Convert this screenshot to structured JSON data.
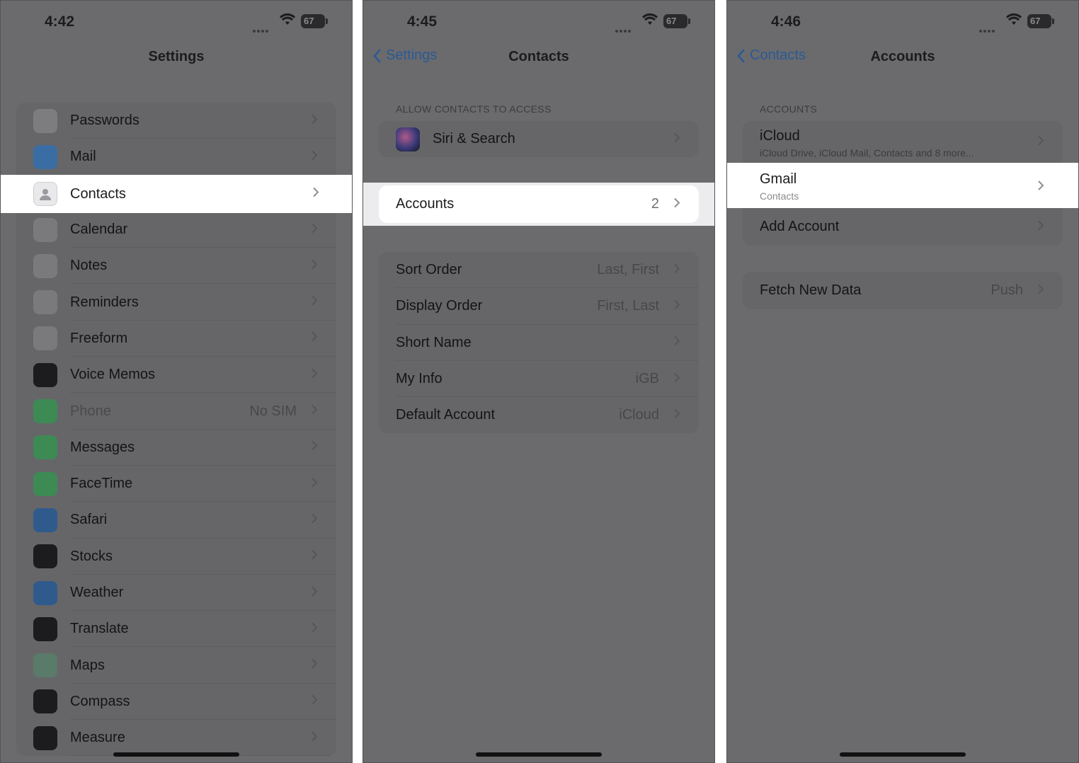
{
  "screen1": {
    "time": "4:42",
    "battery": "67",
    "title": "Settings",
    "items": [
      {
        "label": "Passwords",
        "value": "",
        "icon": "key-icon",
        "color": "#7d7d80"
      },
      {
        "label": "Mail",
        "value": "",
        "icon": "mail-icon",
        "color": "#3a6da3"
      },
      {
        "label": "Contacts",
        "value": "",
        "icon": "contacts-icon",
        "color": "#d8d8da"
      },
      {
        "label": "Calendar",
        "value": "",
        "icon": "calendar-icon",
        "color": "#7a7a7c"
      },
      {
        "label": "Notes",
        "value": "",
        "icon": "notes-icon",
        "color": "#7a7a7c"
      },
      {
        "label": "Reminders",
        "value": "",
        "icon": "reminders-icon",
        "color": "#7a7a7c"
      },
      {
        "label": "Freeform",
        "value": "",
        "icon": "freeform-icon",
        "color": "#7a7a7c"
      },
      {
        "label": "Voice Memos",
        "value": "",
        "icon": "voice-memos-icon",
        "color": "#1c1c1e"
      },
      {
        "label": "Phone",
        "value": "No SIM",
        "icon": "phone-icon",
        "color": "#3d8a55"
      },
      {
        "label": "Messages",
        "value": "",
        "icon": "messages-icon",
        "color": "#3d8a55"
      },
      {
        "label": "FaceTime",
        "value": "",
        "icon": "facetime-icon",
        "color": "#3d8a55"
      },
      {
        "label": "Safari",
        "value": "",
        "icon": "safari-icon",
        "color": "#2f5a8c"
      },
      {
        "label": "Stocks",
        "value": "",
        "icon": "stocks-icon",
        "color": "#1c1c1e"
      },
      {
        "label": "Weather",
        "value": "",
        "icon": "weather-icon",
        "color": "#2f5a8c"
      },
      {
        "label": "Translate",
        "value": "",
        "icon": "translate-icon",
        "color": "#1c1c1e"
      },
      {
        "label": "Maps",
        "value": "",
        "icon": "maps-icon",
        "color": "#5a7a6a"
      },
      {
        "label": "Compass",
        "value": "",
        "icon": "compass-icon",
        "color": "#1c1c1e"
      },
      {
        "label": "Measure",
        "value": "",
        "icon": "measure-icon",
        "color": "#1c1c1e"
      }
    ]
  },
  "screen2": {
    "time": "4:45",
    "battery": "67",
    "back": "Settings",
    "title": "Contacts",
    "section_header": "ALLOW CONTACTS TO ACCESS",
    "siri": "Siri & Search",
    "accounts": {
      "label": "Accounts",
      "value": "2"
    },
    "options": [
      {
        "label": "Sort Order",
        "value": "Last, First"
      },
      {
        "label": "Display Order",
        "value": "First, Last"
      },
      {
        "label": "Short Name",
        "value": ""
      },
      {
        "label": "My Info",
        "value": "iGB"
      },
      {
        "label": "Default Account",
        "value": "iCloud"
      }
    ]
  },
  "screen3": {
    "time": "4:46",
    "battery": "67",
    "back": "Contacts",
    "title": "Accounts",
    "section_header": "ACCOUNTS",
    "icloud": {
      "label": "iCloud",
      "sub": "iCloud Drive, iCloud Mail, Contacts and 8 more..."
    },
    "gmail": {
      "label": "Gmail",
      "sub": "Contacts"
    },
    "add_account": "Add Account",
    "fetch": {
      "label": "Fetch New Data",
      "value": "Push"
    }
  },
  "colors": {
    "highlight": "#ffffff",
    "dim_overlay": "#6b6b6d",
    "link": "#2a5a94"
  }
}
